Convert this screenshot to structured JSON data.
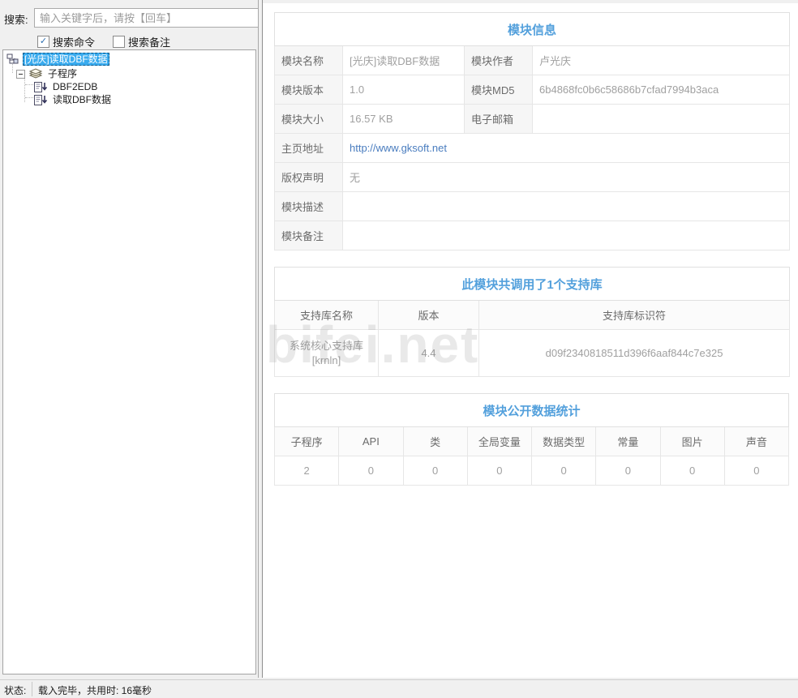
{
  "search": {
    "label": "搜索:",
    "placeholder": "输入关键字后，请按【回车】"
  },
  "filters": {
    "commands_label": "搜索命令",
    "commands_checked": true,
    "notes_label": "搜索备注",
    "notes_checked": false,
    "check_glyph": "✓"
  },
  "tree": {
    "root_label": "[光庆]读取DBF数据",
    "group_label": "子程序",
    "leaf1_label": "DBF2EDB",
    "leaf2_label": "读取DBF数据"
  },
  "module_info": {
    "title": "模块信息",
    "rows4": [
      {
        "l1": "模块名称",
        "v1": "[光庆]读取DBF数据",
        "l2": "模块作者",
        "v2": "卢光庆"
      },
      {
        "l1": "模块版本",
        "v1": "1.0",
        "l2": "模块MD5",
        "v2": "6b4868fc0b6c58686b7cfad7994b3aca"
      },
      {
        "l1": "模块大小",
        "v1": "16.57 KB",
        "l2": "电子邮箱",
        "v2": ""
      }
    ],
    "rows2": [
      {
        "label": "主页地址",
        "value": "http://www.gksoft.net"
      },
      {
        "label": "版权声明",
        "value": "无"
      },
      {
        "label": "模块描述",
        "value": ""
      },
      {
        "label": "模块备注",
        "value": ""
      }
    ]
  },
  "support_libs": {
    "title": "此模块共调用了1个支持库",
    "headers": [
      "支持库名称",
      "版本",
      "支持库标识符"
    ],
    "row": {
      "name_line1": "系统核心支持库",
      "name_line2": "[krnln]",
      "version": "4.4",
      "guid": "d09f2340818511d396f6aaf844c7e325"
    }
  },
  "stats": {
    "title": "模块公开数据统计",
    "headers": [
      "子程序",
      "API",
      "类",
      "全局变量",
      "数据类型",
      "常量",
      "图片",
      "声音"
    ],
    "values": [
      "2",
      "0",
      "0",
      "0",
      "0",
      "0",
      "0",
      "0"
    ]
  },
  "watermark": "bifei.net",
  "status_bar": {
    "label": "状态:",
    "message": "载入完毕，共用时: 16毫秒"
  },
  "colors": {
    "accent_blue": "#53a0dc",
    "link_blue": "#4a7dbf",
    "selection_blue": "#3aabee",
    "label_cell_bg": "#f6f6f6",
    "panel_bg": "#f0f0f0"
  }
}
